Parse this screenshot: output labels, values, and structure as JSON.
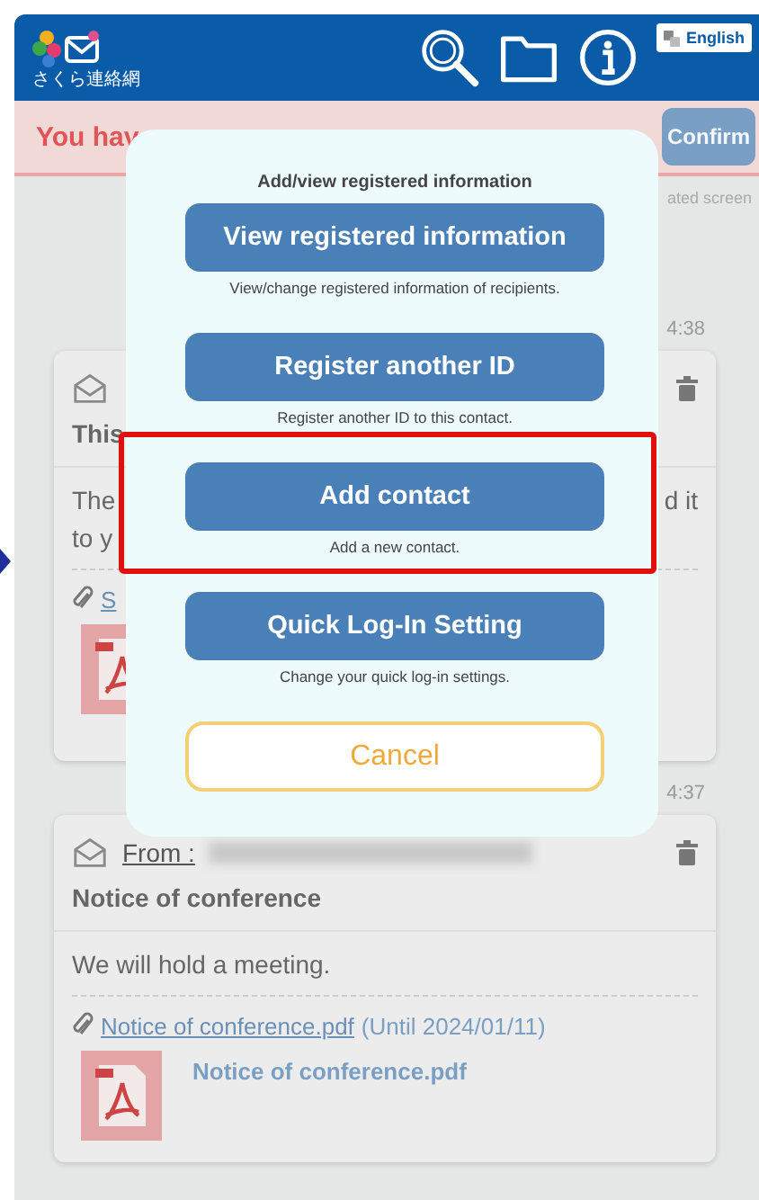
{
  "header": {
    "logo_text": "さくら連絡網",
    "language_button": "English"
  },
  "alert": {
    "message": "You hav",
    "button": "Confirm"
  },
  "note": "ated screen",
  "messages": [
    {
      "time": "4:38",
      "subject": "This",
      "body_lines": [
        {
          "left": "The",
          "right": "d it"
        },
        {
          "left": "to y"
        }
      ],
      "attachment_link": "S"
    },
    {
      "time": "4:37",
      "from_label": "From :",
      "sender_redacted": true,
      "subject": "Notice of conference",
      "body_lines": [
        {
          "left": "We will hold a meeting."
        }
      ],
      "attachment_link": "Notice of conference.pdf",
      "attachment_until": "(Until 2024/01/11)",
      "file_name": "Notice of conference.pdf"
    }
  ],
  "modal": {
    "title": "Add/view registered information",
    "actions": [
      {
        "label": "View registered information",
        "description": "View/change registered information of recipients.",
        "highlighted": false
      },
      {
        "label": "Register another ID",
        "description": "Register another ID to this contact.",
        "highlighted": false
      },
      {
        "label": "Add contact",
        "description": "Add a new contact.",
        "highlighted": true
      },
      {
        "label": "Quick Log-In Setting",
        "description": "Change your quick log-in settings.",
        "highlighted": false
      }
    ],
    "cancel": "Cancel"
  }
}
